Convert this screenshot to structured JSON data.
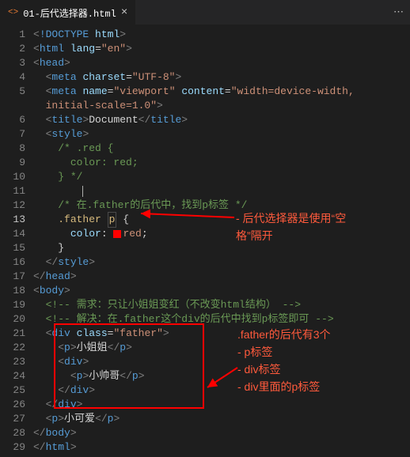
{
  "tab": {
    "icon": "<>",
    "filename": "01-后代选择器.html",
    "close": "×",
    "more": "⋯"
  },
  "gutter_active": 13,
  "lines": {
    "l1": {
      "doctype": "!DOCTYPE",
      "html": "html"
    },
    "l2": {
      "tag": "html",
      "attr": "lang",
      "val": "\"en\""
    },
    "l3": {
      "tag": "head"
    },
    "l4": {
      "tag": "meta",
      "attr": "charset",
      "val": "\"UTF-8\""
    },
    "l5": {
      "tag": "meta",
      "attr1": "name",
      "val1": "\"viewport\"",
      "attr2": "content",
      "val2": "\"width=device-width, "
    },
    "l5b": {
      "cont": "initial-scale=1.0\""
    },
    "l6": {
      "open": "title",
      "text": "Document",
      "close": "title"
    },
    "l7": {
      "tag": "style"
    },
    "l8": {
      "c": "/* .red {"
    },
    "l9": {
      "c": "  color: red;"
    },
    "l10": {
      "c": "} */"
    },
    "l12": {
      "c": "/* 在.father的后代中，找到p标签 */"
    },
    "l13": {
      "sel1": ".father",
      "sel2": "p",
      "brace": "{"
    },
    "l14": {
      "prop": "color",
      "val": "red",
      "semi": ";"
    },
    "l15": {
      "brace": "}"
    },
    "l16": {
      "close": "style"
    },
    "l17": {
      "close": "head"
    },
    "l18": {
      "tag": "body"
    },
    "l19": {
      "c": "<!-- 需求：只让小姐姐变红（不改变html结构） -->"
    },
    "l20": {
      "c": "<!-- 解决：在.father这个div的后代中找到p标签即可 -->"
    },
    "l21": {
      "tag": "div",
      "attr": "class",
      "val": "\"father\""
    },
    "l22": {
      "open": "p",
      "text": "小姐姐",
      "close": "p"
    },
    "l23": {
      "tag": "div"
    },
    "l24": {
      "open": "p",
      "text": "小帅哥",
      "close": "p"
    },
    "l25": {
      "close": "div"
    },
    "l26": {
      "close": "div"
    },
    "l27": {
      "open": "p",
      "text": "小可爱",
      "close": "p"
    },
    "l28": {
      "close": "body"
    },
    "l29": {
      "close": "html"
    }
  },
  "anno1": {
    "a": "- 后代选择器是使用“空",
    "b": "格”隔开"
  },
  "anno2": {
    "a": ".father的后代有3个",
    "b": "- p标签",
    "c": "- div标签",
    "d": "- div里面的p标签"
  }
}
